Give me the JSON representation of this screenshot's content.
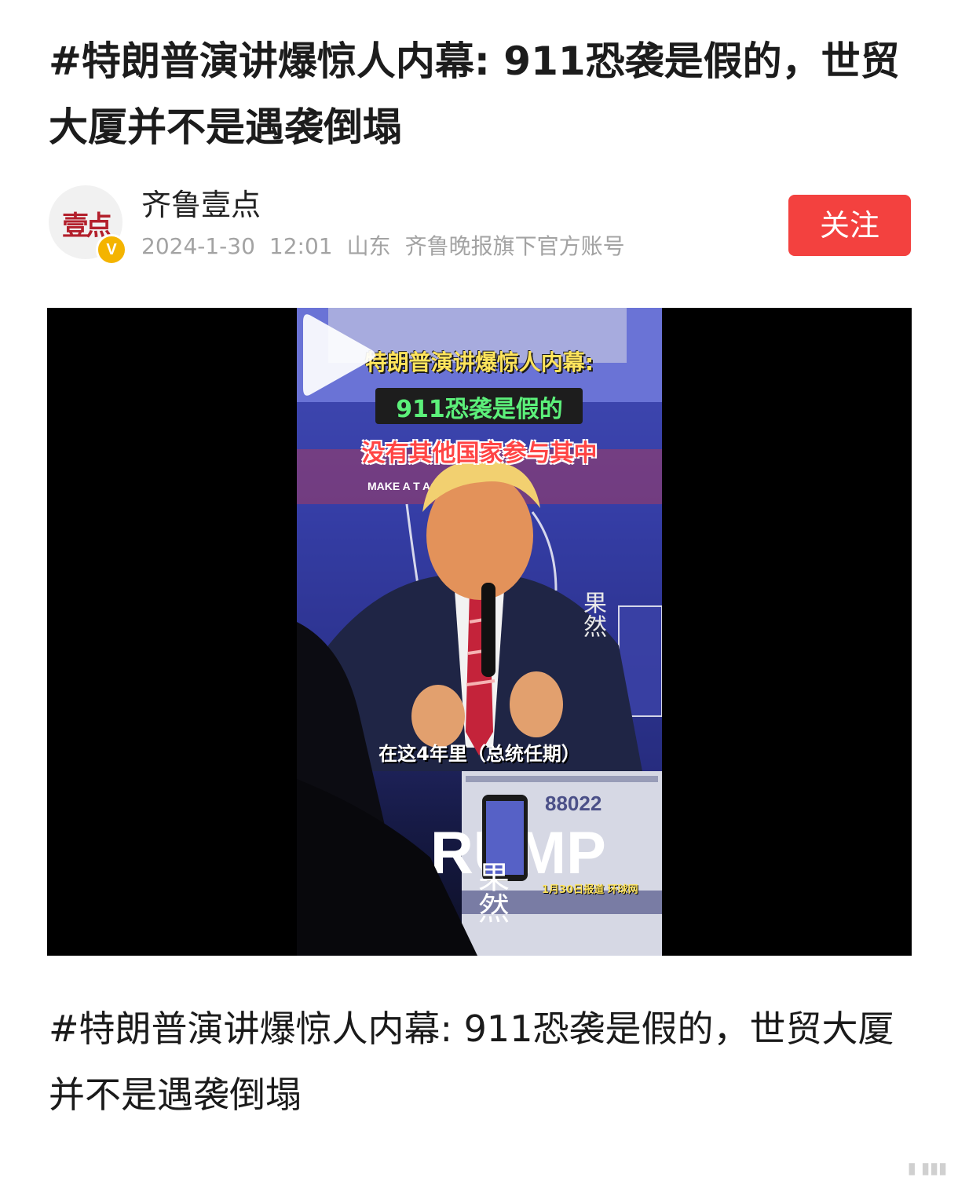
{
  "article": {
    "title": "#特朗普演讲爆惊人内幕: 911恐袭是假的，世贸大厦并不是遇袭倒塌",
    "body": "#特朗普演讲爆惊人内幕: 911恐袭是假的，世贸大厦并不是遇袭倒塌"
  },
  "author": {
    "avatar_logo_text": "壹点",
    "verified_badge": "V",
    "name": "齐鲁壹点",
    "date": "2024-1-30",
    "time": "12:01",
    "location": "山东",
    "description": "齐鲁晚报旗下官方账号",
    "follow_label": "关注"
  },
  "video": {
    "caption_line1": "特朗普演讲爆惊人内幕:",
    "caption_line2": "911恐袭是假的",
    "caption_line3": "没有其他国家参与其中",
    "subtitle": "在这4年里（总统任期）",
    "source_note": "1月30日报道 环球网",
    "watermark": "果然",
    "banner_text_top": "MAKE A     T AGAIN!",
    "banner_text_bottom": "RUMP",
    "banner_number": "88022",
    "play_icon": "play-icon"
  },
  "colors": {
    "follow_button": "#f3413f",
    "caption_yellow": "#ffe45c",
    "caption_green": "#5cf07a",
    "caption_red": "#ff4444",
    "meta_gray": "#a3a3a3"
  }
}
